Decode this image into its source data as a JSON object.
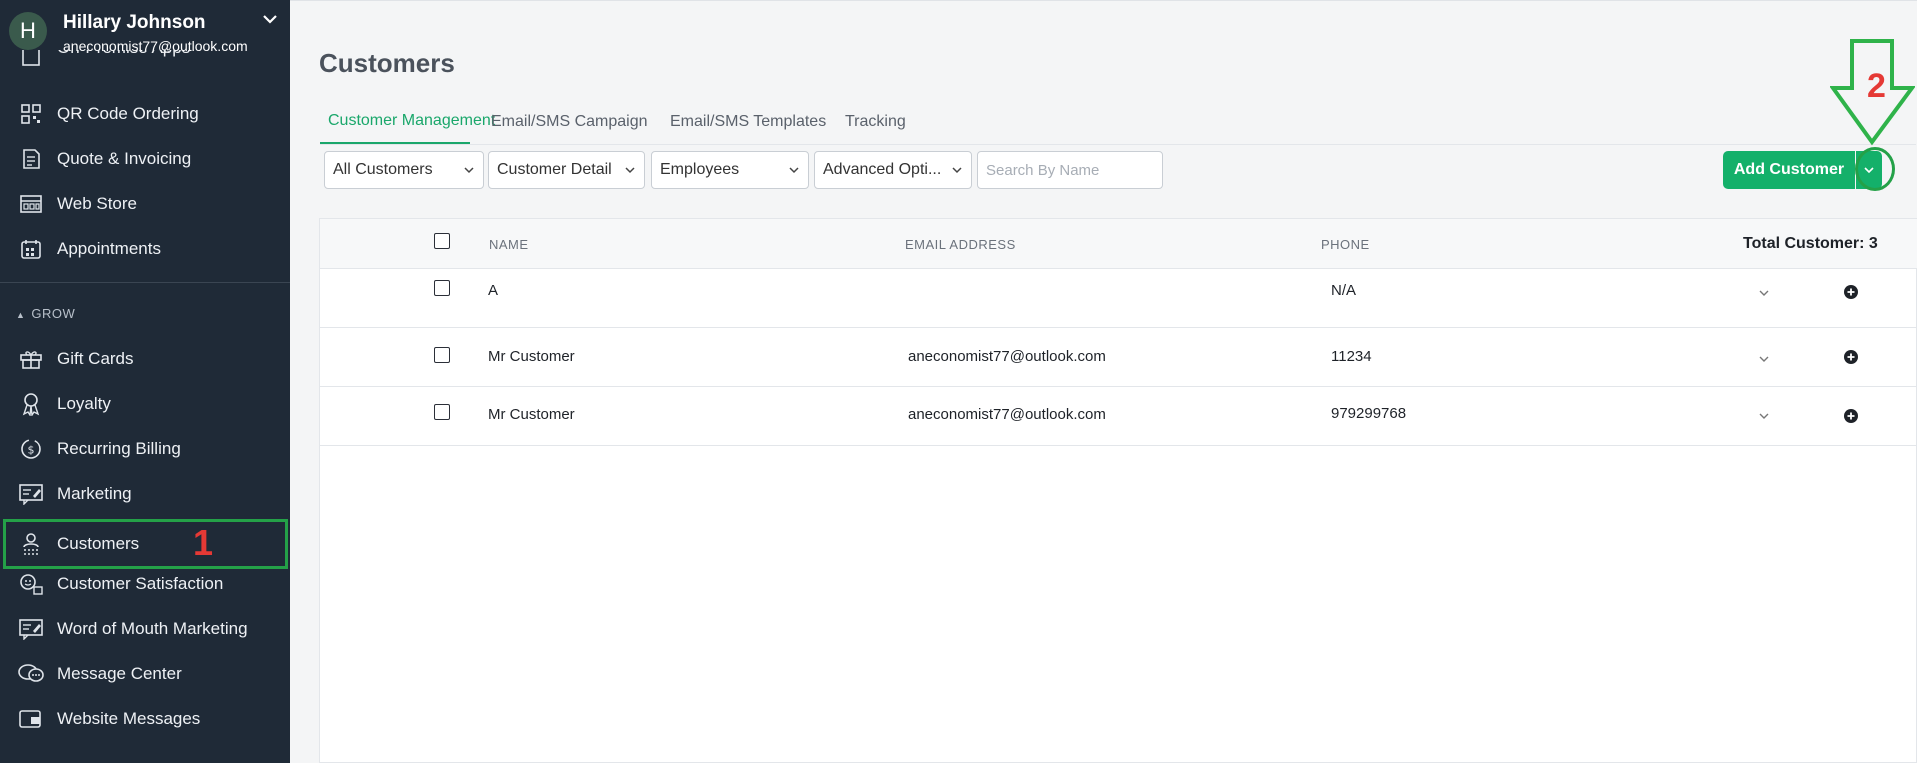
{
  "profile": {
    "initial": "H",
    "name": "Hillary Johnson",
    "email": "aneconomist77@outlook.com"
  },
  "sidebar": {
    "items_top": [
      {
        "label": "On-Premise Apps",
        "icon": "apps-icon"
      },
      {
        "label": "QR Code Ordering",
        "icon": "qr-code-icon"
      },
      {
        "label": "Quote & Invoicing",
        "icon": "invoice-icon"
      },
      {
        "label": "Web Store",
        "icon": "web-store-icon"
      },
      {
        "label": "Appointments",
        "icon": "calendar-icon"
      }
    ],
    "section_grow": "GROW",
    "items_grow": [
      {
        "label": "Gift Cards",
        "icon": "gift-icon"
      },
      {
        "label": "Loyalty",
        "icon": "award-icon"
      },
      {
        "label": "Recurring Billing",
        "icon": "recurring-billing-icon"
      },
      {
        "label": "Marketing",
        "icon": "marketing-icon"
      },
      {
        "label": "Customers",
        "icon": "customers-icon"
      },
      {
        "label": "Customer Satisfaction",
        "icon": "satisfaction-icon"
      },
      {
        "label": "Word of Mouth Marketing",
        "icon": "word-of-mouth-icon"
      },
      {
        "label": "Message Center",
        "icon": "chat-icon"
      },
      {
        "label": "Website Messages",
        "icon": "website-messages-icon"
      }
    ]
  },
  "annotations": {
    "one": "1",
    "two": "2"
  },
  "page": {
    "title": "Customers",
    "tabs": [
      "Customer Management",
      "Email/SMS Campaign",
      "Email/SMS Templates",
      "Tracking"
    ],
    "active_tab": 0
  },
  "filters": {
    "customers": "All Customers",
    "detail": "Customer Detail",
    "employees": "Employees",
    "advanced": "Advanced Opti...",
    "search_placeholder": "Search By Name"
  },
  "add_button": "Add Customer",
  "table": {
    "headers": {
      "name": "NAME",
      "email": "EMAIL ADDRESS",
      "phone": "PHONE"
    },
    "total": "Total Customer: 3",
    "rows": [
      {
        "name": "A",
        "email": "",
        "phone": "N/A"
      },
      {
        "name": "Mr Customer",
        "email": "aneconomist77@outlook.com",
        "phone": "11234"
      },
      {
        "name": "Mr Customer",
        "email": "aneconomist77@outlook.com",
        "phone": "979299768"
      }
    ]
  },
  "colors": {
    "sidebar_bg": "#1f2a37",
    "accent": "#14b06a",
    "annotation_green": "#24a148",
    "annotation_red": "#e53935"
  }
}
